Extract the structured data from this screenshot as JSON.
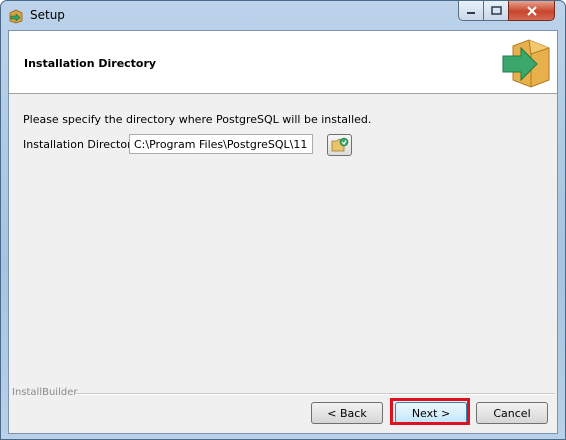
{
  "window": {
    "title": "Setup",
    "controls": [
      "minimize",
      "maximize",
      "close"
    ]
  },
  "header": {
    "title": "Installation Directory",
    "icon": "box-arrow-icon"
  },
  "content": {
    "instruction": "Please specify the directory where PostgreSQL will be installed.",
    "directory_label": "Installation Directory",
    "directory_value": "C:\\Program Files\\PostgreSQL\\11",
    "browse_icon": "folder-browse-icon"
  },
  "footer": {
    "brand": "InstallBuilder",
    "back_label": "< Back",
    "next_label": "Next >",
    "cancel_label": "Cancel"
  },
  "colors": {
    "highlight": "#e0101e",
    "arrow": "#3aa86b",
    "box": "#e8b04a"
  }
}
